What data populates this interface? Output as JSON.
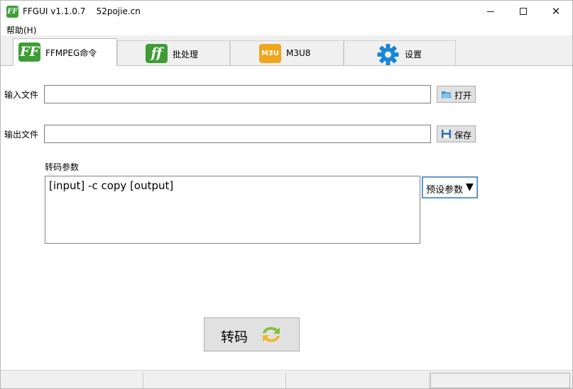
{
  "window": {
    "title": "FFGUI v1.1.0.7    52pojie.cn",
    "app_icon_text": "FF"
  },
  "menu": {
    "help": "帮助(H)"
  },
  "tabs": [
    {
      "label": "FFMPEG命令",
      "icon": "ff-logo-icon",
      "icon_text": "FF",
      "active": true
    },
    {
      "label": "批处理",
      "icon": "ff-batch-icon",
      "icon_text": "ff",
      "active": false
    },
    {
      "label": "M3U8",
      "icon": "m3u-icon",
      "icon_text": "M3U",
      "active": false
    },
    {
      "label": "设置",
      "icon": "gear-icon",
      "active": false
    }
  ],
  "form": {
    "input_label": "输入文件",
    "input_value": "",
    "open_button": "打开",
    "output_label": "输出文件",
    "output_value": "",
    "save_button": "保存",
    "params_label": "转码参数",
    "params_value": "[input] -c copy [output]",
    "preset_button": "预设参数",
    "preset_arrow": "▼",
    "convert_button": "转码"
  },
  "colors": {
    "ff_green": "#3e9c35",
    "m3u_orange": "#f0a51d",
    "gear_blue": "#1a86d4",
    "focus_border": "#3c7fb1"
  }
}
